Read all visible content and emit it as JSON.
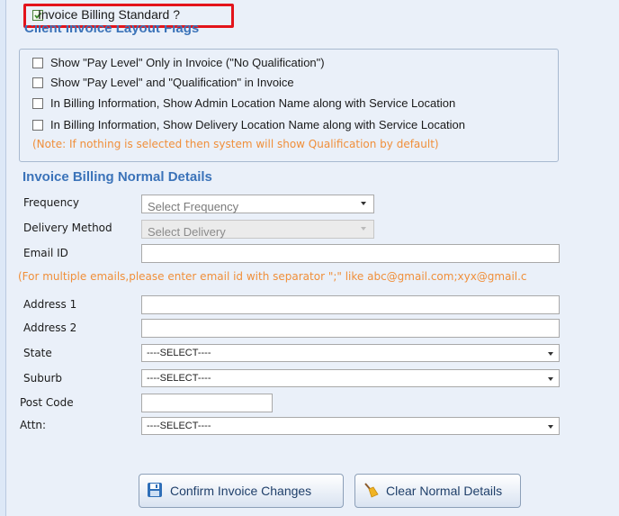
{
  "billing_standard": {
    "label": "Invoice Billing Standard ?",
    "checked": true
  },
  "layout_flags": {
    "title": "Client Invoice Layout Flags",
    "options": [
      {
        "label": "Show \"Pay Level\" Only in Invoice (\"No Qualification\")",
        "checked": false
      },
      {
        "label": "Show \"Pay Level\" and \"Qualification\" in Invoice",
        "checked": false
      },
      {
        "label": "In Billing Information, Show Admin Location Name along with Service Location",
        "checked": false
      },
      {
        "label": "In Billing Information, Show Delivery Location Name along with Service Location",
        "checked": false
      }
    ],
    "note": "(Note: If nothing is selected then system will show Qualification by default)"
  },
  "normal_details": {
    "title": "Invoice Billing Normal Details",
    "frequency": {
      "label": "Frequency",
      "value": "Select Frequency"
    },
    "delivery_method": {
      "label": "Delivery Method",
      "value": "Select Delivery"
    },
    "email": {
      "label": "Email ID",
      "value": ""
    },
    "email_hint": "(For multiple emails,please enter email id with separator \";\" like abc@gmail.com;xyx@gmail.c",
    "address1": {
      "label": "Address 1",
      "value": ""
    },
    "address2": {
      "label": "Address 2",
      "value": ""
    },
    "state": {
      "label": "State",
      "value": "----SELECT----"
    },
    "suburb": {
      "label": "Suburb",
      "value": "----SELECT----"
    },
    "postcode": {
      "label": "Post Code",
      "value": ""
    },
    "attn": {
      "label": "Attn:",
      "value": "----SELECT----"
    }
  },
  "buttons": {
    "confirm": "Confirm Invoice Changes",
    "clear": "Clear Normal Details"
  },
  "icons": {
    "confirm": "save-disk-icon",
    "clear": "broom-icon"
  },
  "colors": {
    "section_title": "#3b73b9",
    "note": "#f08f3a",
    "highlight": "#e3141b"
  }
}
